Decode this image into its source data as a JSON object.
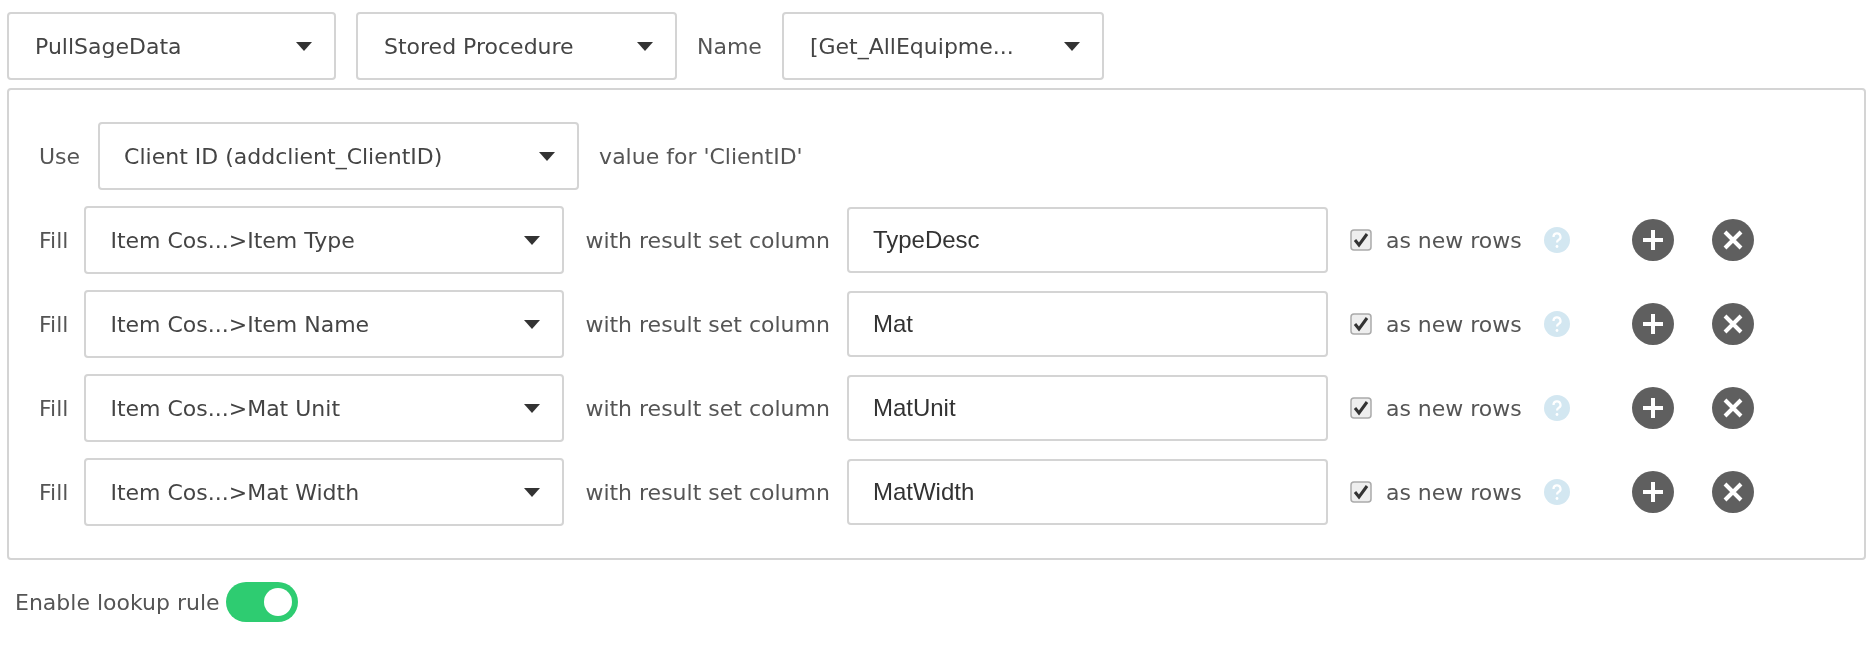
{
  "source": {
    "connection": "PullSageData",
    "type": "Stored Procedure",
    "name_label": "Name",
    "name": "[Get_AllEquipme..."
  },
  "use_row": {
    "label": "Use",
    "field": "Client ID (addclient_ClientID)",
    "suffix": "value for 'ClientID'"
  },
  "fill_rows": [
    {
      "label": "Fill",
      "target": "Item Cos...>Item Type",
      "middle": "with result set column",
      "column": "TypeDesc",
      "as_new_rows": true,
      "checkbox_label": "as new rows"
    },
    {
      "label": "Fill",
      "target": "Item Cos...>Item Name",
      "middle": "with result set column",
      "column": "Mat",
      "as_new_rows": true,
      "checkbox_label": "as new rows"
    },
    {
      "label": "Fill",
      "target": "Item Cos...>Mat Unit",
      "middle": "with result set column",
      "column": "MatUnit",
      "as_new_rows": true,
      "checkbox_label": "as new rows"
    },
    {
      "label": "Fill",
      "target": "Item Cos...>Mat Width",
      "middle": "with result set column",
      "column": "MatWidth",
      "as_new_rows": true,
      "checkbox_label": "as new rows"
    }
  ],
  "enable": {
    "label": "Enable lookup rule",
    "on": true
  }
}
